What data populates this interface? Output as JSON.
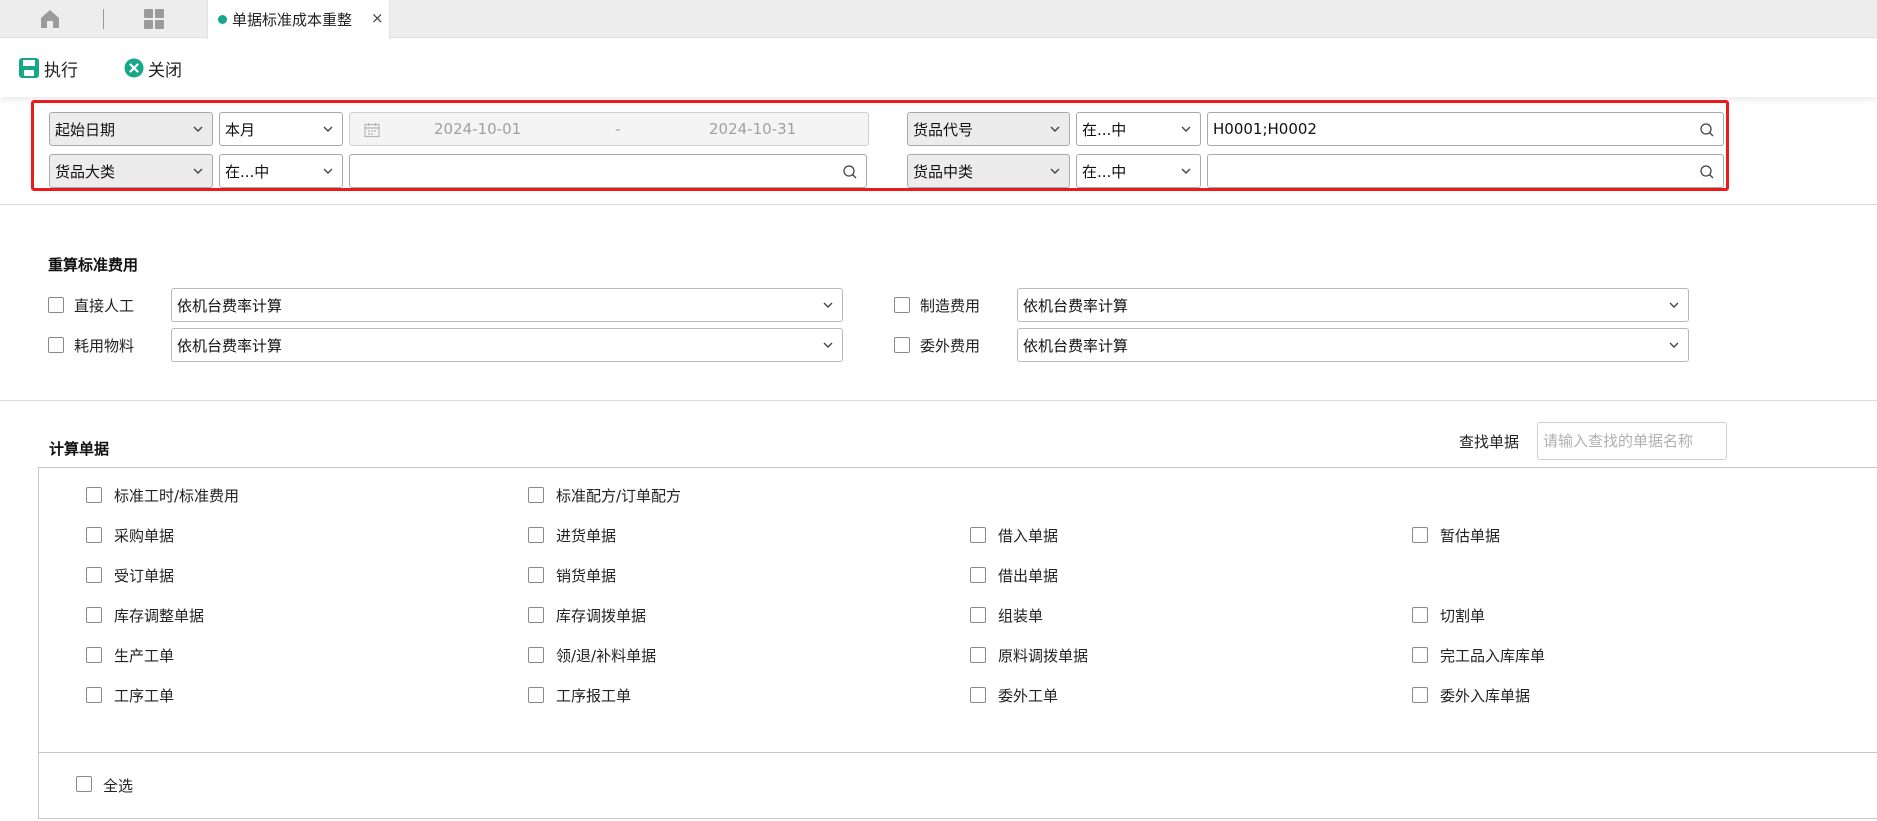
{
  "tabs": {
    "active_title": "单据标准成本重整",
    "close_glyph": "×",
    "active_dot_color": "#16a889"
  },
  "toolbar": {
    "execute_label": "执行",
    "close_label": "关闭"
  },
  "filters": {
    "row1": {
      "field1": "起始日期",
      "period": "本月",
      "date_from": "2024-10-01",
      "date_sep": "-",
      "date_to": "2024-10-31",
      "field2": "货品代号",
      "op2": "在...中",
      "value2": "H0001;H0002"
    },
    "row2": {
      "field1": "货品大类",
      "op1": "在...中",
      "value1": "",
      "field2": "货品中类",
      "op2": "在...中",
      "value2": ""
    }
  },
  "recalc": {
    "title": "重算标准费用",
    "items": [
      {
        "label": "直接人工",
        "value": "依机台费率计算",
        "checked": false
      },
      {
        "label": "制造费用",
        "value": "依机台费率计算",
        "checked": false
      },
      {
        "label": "耗用物料",
        "value": "依机台费率计算",
        "checked": false
      },
      {
        "label": "委外费用",
        "value": "依机台费率计算",
        "checked": false
      }
    ]
  },
  "docs": {
    "title": "计算单据",
    "search_label": "查找单据",
    "search_placeholder": "请输入查找的单据名称",
    "rows": [
      [
        "标准工时/标准费用",
        "标准配方/订单配方",
        "",
        ""
      ],
      [
        "采购单据",
        "进货单据",
        "借入单据",
        "暂估单据"
      ],
      [
        "受订单据",
        "销货单据",
        "借出单据",
        ""
      ],
      [
        "库存调整单据",
        "库存调拨单据",
        "组装单",
        "切割单"
      ],
      [
        "生产工单",
        "领/退/补料单据",
        "原料调拨单据",
        "完工品入库库单"
      ],
      [
        "工序工单",
        "工序报工单",
        "委外工单",
        "委外入库单据"
      ]
    ],
    "select_all_label": "全选"
  },
  "colors": {
    "accent": "#16a889",
    "highlight_border": "#e81c1c"
  }
}
